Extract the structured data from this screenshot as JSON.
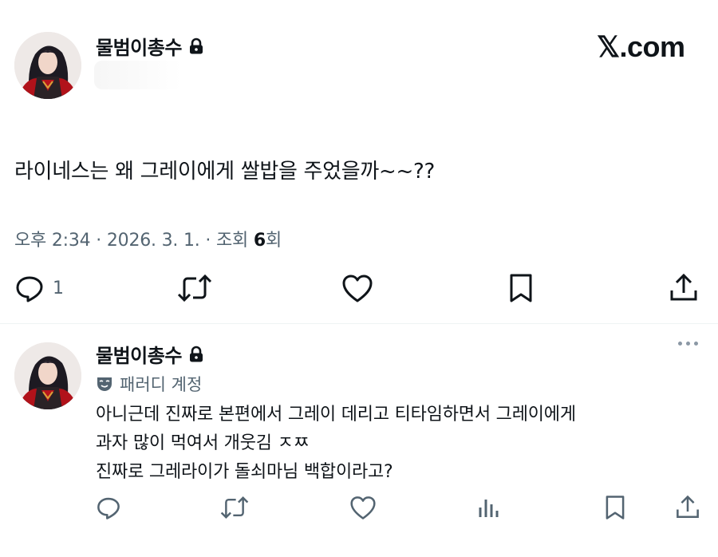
{
  "post": {
    "author_name": "물범이총수",
    "brand": "𝕏.com",
    "text": "라이네스는 왜 그레이에게 쌀밥을 주었을까~~??",
    "meta_time": "오후 2:34 · 2026. 3. 1. · 조회 ",
    "meta_views": "6",
    "meta_suffix": "회",
    "reply_count": "1",
    "icons": [
      "lock-icon",
      "reply-icon",
      "repost-icon",
      "like-icon",
      "bookmark-icon",
      "share-icon"
    ]
  },
  "reply": {
    "author_name": "물범이총수",
    "badge_label": "패러디 계정",
    "lines": [
      "아니근데 진짜로 본편에서 그레이 데리고 티타임하면서 그레이에게",
      "과자 많이 먹여서 개웃김 ㅈㅉ",
      "진짜로 그레라이가 돌쇠마님 백합이라고?"
    ],
    "icons": [
      "more-icon",
      "mask-icon",
      "reply-icon",
      "repost-icon",
      "like-icon",
      "views-icon",
      "bookmark-icon",
      "share-icon"
    ]
  },
  "colors": {
    "text": "#0f1419",
    "secondary": "#536471",
    "divider": "#eff3f4"
  }
}
